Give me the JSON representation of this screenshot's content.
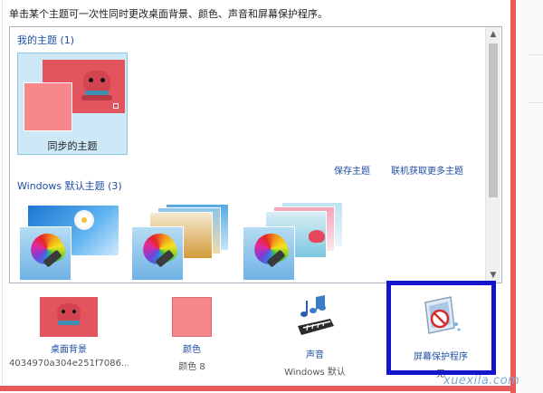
{
  "instruction": "单击某个主题可一次性同时更改桌面背景、颜色、声音和屏幕保护程序。",
  "my_themes": {
    "group_title": "我的主题 (1)",
    "items": [
      {
        "label": "同步的主题",
        "selected": true
      }
    ]
  },
  "links": {
    "save_theme": "保存主题",
    "get_more": "联机获取更多主题"
  },
  "windows_themes": {
    "group_title": "Windows 默认主题 (3)"
  },
  "bottom_bar": {
    "wallpaper": {
      "label": "桌面背景",
      "value": "4034970a304e251f7086..."
    },
    "color": {
      "label": "颜色",
      "value": "颜色 8"
    },
    "sound": {
      "label": "声音",
      "value": "Windows 默认"
    },
    "screensaver": {
      "label": "屏幕保护程序",
      "value": "无"
    }
  },
  "watermark": "xuexila.com",
  "colors": {
    "accent_red": "#e85a5a",
    "highlight_blue": "#1414cc",
    "link_blue": "#1e4ea3",
    "selection_bg": "#cde8f7",
    "theme_color": "#f6878b"
  }
}
